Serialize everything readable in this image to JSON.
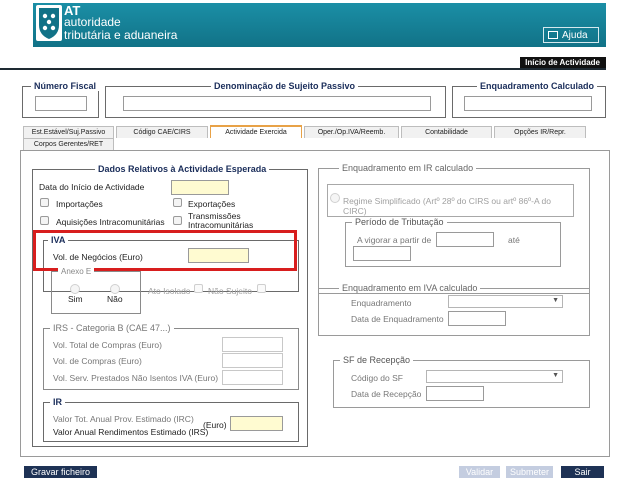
{
  "header": {
    "logo_at": "AT",
    "logo_line1": "autoridade",
    "logo_line2": "tributária e aduaneira",
    "help": "Ajuda",
    "section": "Início de Actividade",
    "brand_color": "#117287"
  },
  "top_fields": {
    "nif_label": "Número Fiscal",
    "denominacao_label": "Denominação de Sujeito Passivo",
    "enquadramento_label": "Enquadramento Calculado"
  },
  "tabs": [
    "Est.Estável/Suj.Passivo",
    "Código CAE/CIRS",
    "Actividade Exercida",
    "Oper./Op.IVA/Reemb.",
    "Contabilidade",
    "Opções IR/Repr.",
    "Corpos Gerentes/RET"
  ],
  "active_tab": "Actividade Exercida",
  "dados": {
    "legend": "Dados Relativos à Actividade Esperada",
    "data_inicio": "Data do Início de Actividade",
    "importacoes": "Importações",
    "exportacoes": "Exportações",
    "aquisicoes": "Aquisições Intracomunitárias",
    "transmissoes": "Transmissões Intracomunitárias"
  },
  "iva": {
    "legend": "IVA",
    "vol_negocios": "Vol. de Negócios (Euro)",
    "anexo": "Anexo E",
    "sim": "Sim",
    "nao": "Não",
    "ato_isolado": "Ato Isolado",
    "nao_sujeito": "Não Sujeito"
  },
  "irs": {
    "legend": "IRS - Categoria B (CAE 47...)",
    "vol_compras_total": "Vol. Total de Compras (Euro)",
    "vol_compras": "Vol. de Compras (Euro)",
    "vol_serv": "Vol. Serv. Prestados Não Isentos IVA (Euro)"
  },
  "ir": {
    "legend": "IR",
    "valor_tot": "Valor Tot. Anual Prov. Estimado (IRC)",
    "valor_anual": "Valor Anual Rendimentos Estimado (IRS)",
    "euro": "(Euro)"
  },
  "enq_ir": {
    "legend": "Enquadramento em IR calculado",
    "regime_l1": "Regime Simplificado (Artº 28º do CIRS ou artº 86º-A do",
    "regime_l2": "CIRC)",
    "periodo_legend": "Período de Tributação",
    "vigorar": "A vigorar a partir de",
    "ate": "até"
  },
  "enq_iva": {
    "legend": "Enquadramento em IVA calculado",
    "enquadramento": "Enquadramento",
    "data_enq": "Data de Enquadramento"
  },
  "sf": {
    "legend": "SF de Recepção",
    "codigo": "Código do SF",
    "data_rec": "Data de Recepção"
  },
  "footer": {
    "save": "Gravar ficheiro",
    "validar": "Validar",
    "submeter": "Submeter",
    "sair": "Sair"
  }
}
